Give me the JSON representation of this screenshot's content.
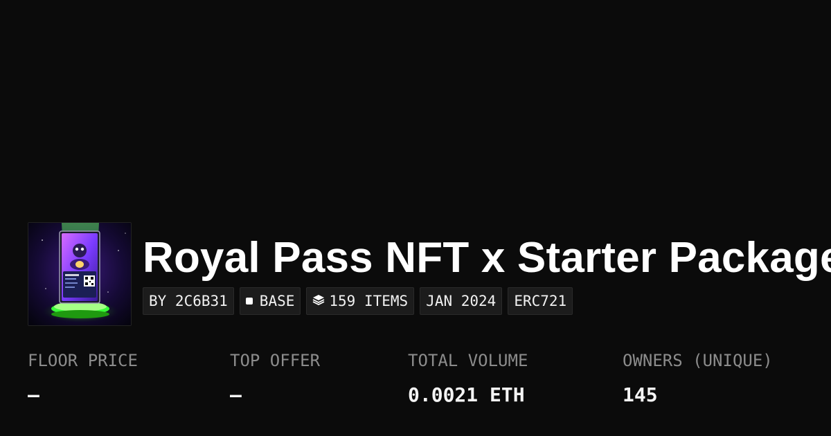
{
  "collection": {
    "title": "Royal Pass NFT x Starter Package",
    "badges": {
      "creator": "BY 2C6B31",
      "chain": "BASE",
      "items": "159 ITEMS",
      "date": "JAN 2024",
      "standard": "ERC721"
    },
    "image_alt": "collection-card-image"
  },
  "stats": [
    {
      "label": "FLOOR PRICE",
      "value": "–"
    },
    {
      "label": "TOP OFFER",
      "value": "–"
    },
    {
      "label": "TOTAL VOLUME",
      "value": "0.0021 ETH"
    },
    {
      "label": "OWNERS (UNIQUE)",
      "value": "145"
    }
  ],
  "colors": {
    "background": "#0b0b0b",
    "badge_bg": "#1c1c1c",
    "accent_green": "#39ff3a",
    "accent_purple": "#7b3cff",
    "label_gray": "#8c8c8c"
  },
  "icons": {
    "chain": "square-dot-icon",
    "items": "layers-icon"
  }
}
